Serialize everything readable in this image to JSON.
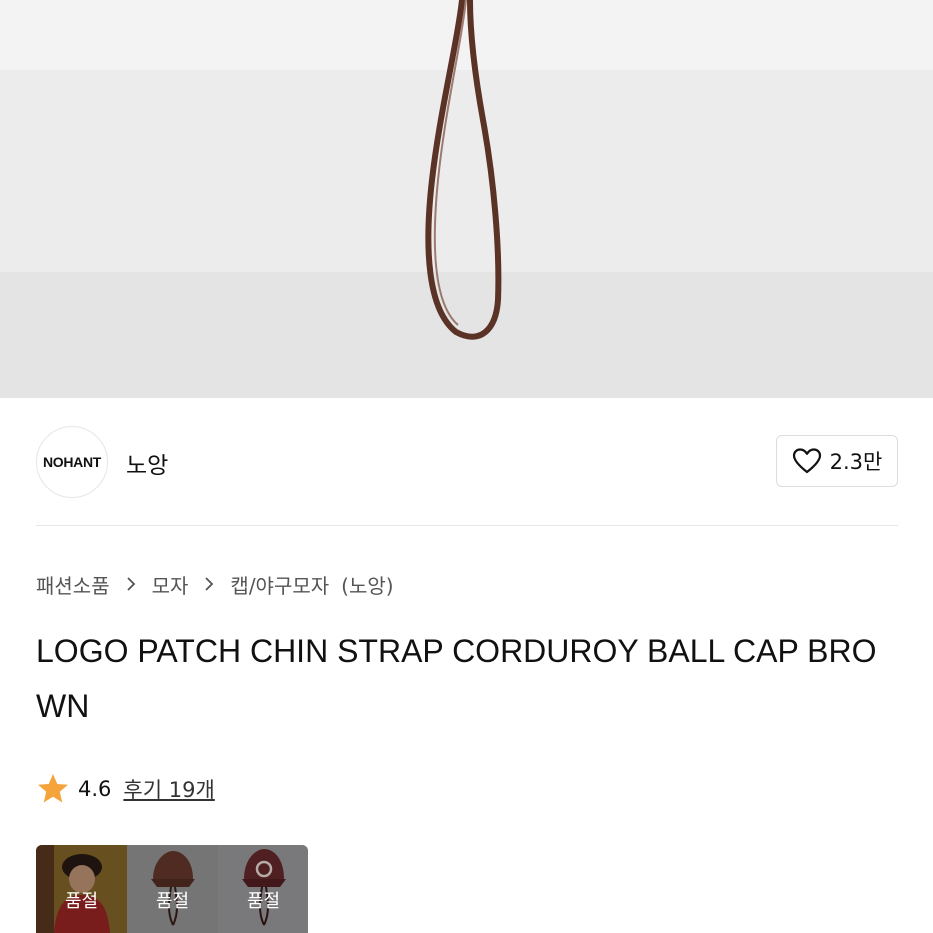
{
  "brand": {
    "logo_text": "NOHANT",
    "name": "노앙"
  },
  "like": {
    "count": "2.3만"
  },
  "breadcrumb": [
    "패션소품",
    "모자",
    "캡/야구모자",
    "(노앙)"
  ],
  "product": {
    "title": "LOGO PATCH CHIN STRAP CORDUROY BALL CAP BROWN"
  },
  "rating": {
    "score": "4.6",
    "reviews_label": "후기 19개"
  },
  "thumbs": [
    {
      "badge": "품절"
    },
    {
      "badge": "품절"
    },
    {
      "badge": "품절"
    }
  ],
  "colors": {
    "strap": "#5a3326",
    "star": "#f5a33b",
    "hero_bg": "#ececed"
  }
}
